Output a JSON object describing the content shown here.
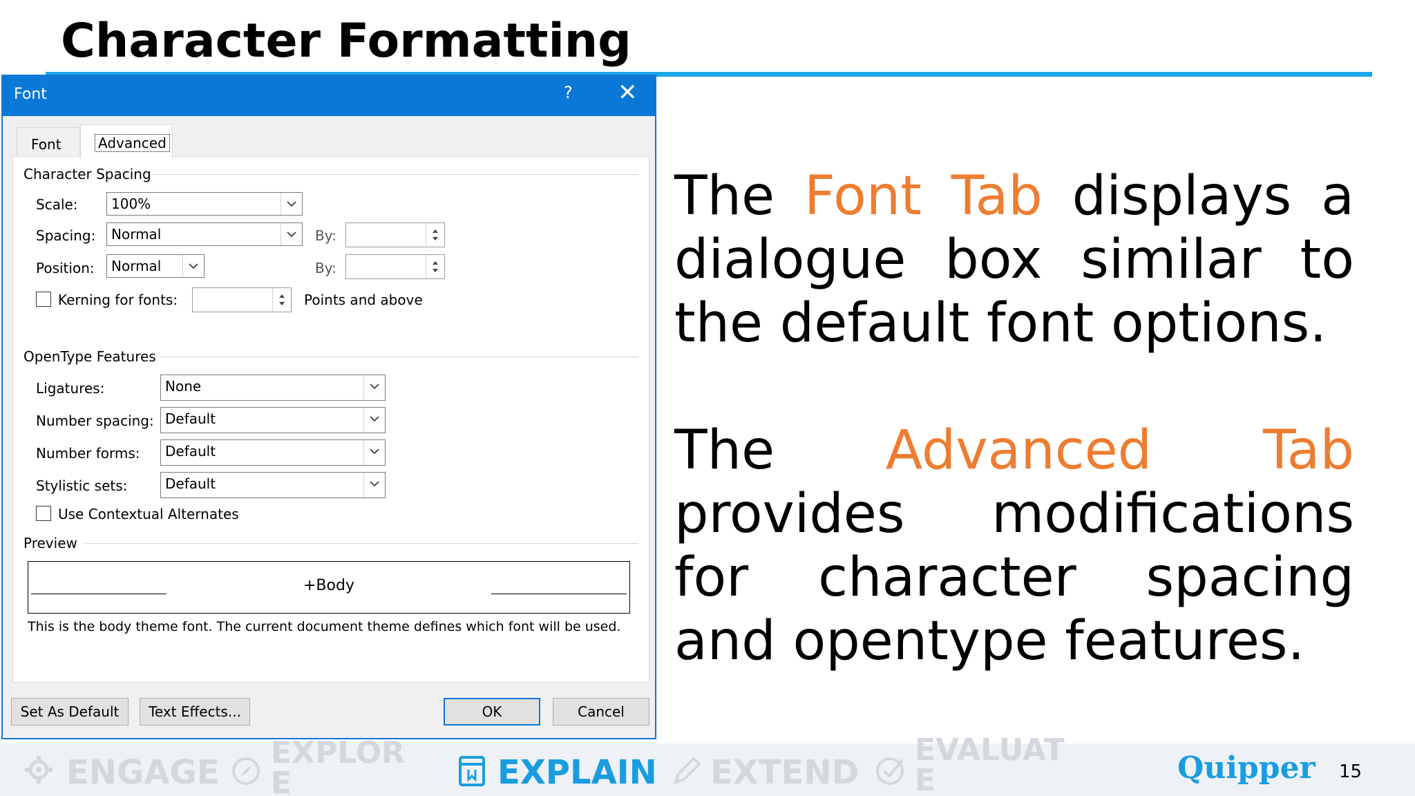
{
  "slide": {
    "title": "Character Formatting",
    "paragraph1": {
      "before": "The ",
      "accent": "Font Tab",
      "after": " displays a dialogue box similar to the default font options."
    },
    "paragraph2": {
      "before": "The ",
      "accent": "Advanced Tab",
      "after": " provides modifications for character spacing and opentype features."
    },
    "accent_color": "#ed7d31",
    "rule_color": "#1aa7e6"
  },
  "dialog": {
    "title": "Font",
    "help": "?",
    "close": "✕",
    "titlebar_color": "#0b78d7",
    "tabs": [
      {
        "label": "Font",
        "selected": false
      },
      {
        "label": "Advanced",
        "selected": true
      }
    ],
    "character_spacing": {
      "heading": "Character Spacing",
      "scale_label": "Scale:",
      "scale_value": "100%",
      "spacing_label": "Spacing:",
      "spacing_value": "Normal",
      "spacing_by_label": "By:",
      "spacing_by_value": "",
      "position_label": "Position:",
      "position_value": "Normal",
      "position_by_label": "By:",
      "position_by_value": "",
      "kerning_label": "Kerning for fonts:",
      "kerning_checked": false,
      "kerning_value": "",
      "kerning_suffix": "Points and above"
    },
    "opentype": {
      "heading": "OpenType Features",
      "ligatures_label": "Ligatures:",
      "ligatures_value": "None",
      "number_spacing_label": "Number spacing:",
      "number_spacing_value": "Default",
      "number_forms_label": "Number forms:",
      "number_forms_value": "Default",
      "stylistic_sets_label": "Stylistic sets:",
      "stylistic_sets_value": "Default",
      "contextual_label": "Use Contextual Alternates",
      "contextual_checked": false
    },
    "preview": {
      "heading": "Preview",
      "sample": "+Body",
      "note": "This is the body theme font. The current document theme defines which font will be used."
    },
    "buttons": {
      "set_default": "Set As Default",
      "text_effects": "Text Effects...",
      "ok": "OK",
      "cancel": "Cancel"
    }
  },
  "footer": {
    "steps": [
      {
        "label": "ENGAGE",
        "icon": "gear-icon",
        "active": false
      },
      {
        "label": "EXPLORE",
        "icon": "compass-icon",
        "active": false
      },
      {
        "label": "EXPLAIN",
        "icon": "book-icon",
        "active": true
      },
      {
        "label": "EXTEND",
        "icon": "pencil-icon",
        "active": false
      },
      {
        "label": "EVALUATE",
        "icon": "check-circle-icon",
        "active": false
      }
    ],
    "brand": "Quipper",
    "page_number": "15",
    "active_color": "#1a9de0",
    "inactive_color": "#d4d8de"
  }
}
